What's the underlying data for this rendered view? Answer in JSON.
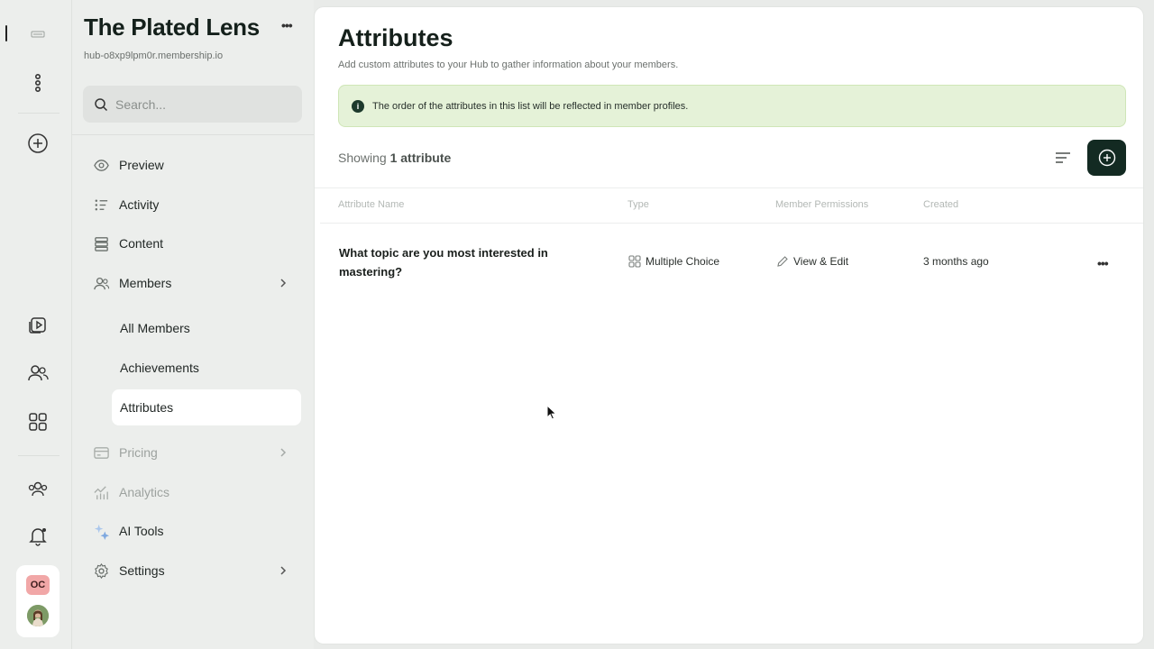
{
  "sidebar": {
    "brand_title": "The Plated Lens",
    "brand_more": "•••",
    "hub_url": "hub-o8xp9lpm0r.membership.io",
    "search_placeholder": "Search...",
    "nav": {
      "preview": "Preview",
      "activity": "Activity",
      "content": "Content",
      "members": "Members",
      "all_members": "All Members",
      "achievements": "Achievements",
      "attributes": "Attributes",
      "pricing": "Pricing",
      "analytics": "Analytics",
      "ai_tools": "AI Tools",
      "settings": "Settings"
    }
  },
  "rail": {
    "user_initials": "OC"
  },
  "main": {
    "title": "Attributes",
    "subtitle": "Add custom attributes to your Hub to gather information about your members.",
    "notice": "The order of the attributes in this list will be reflected in member profiles.",
    "showing_prefix": "Showing",
    "showing_count": "1 attribute",
    "columns": {
      "name": "Attribute Name",
      "type": "Type",
      "permissions": "Member Permissions",
      "created": "Created"
    },
    "rows": [
      {
        "name": "What topic are you most interested in mastering?",
        "type": "Multiple Choice",
        "permissions": "View & Edit",
        "created": "3 months ago",
        "more": "•••"
      }
    ]
  },
  "colors": {
    "accent_dark": "#132a22",
    "notice_bg": "#e5f2d8",
    "avatar_oc": "#f1a7a7"
  }
}
